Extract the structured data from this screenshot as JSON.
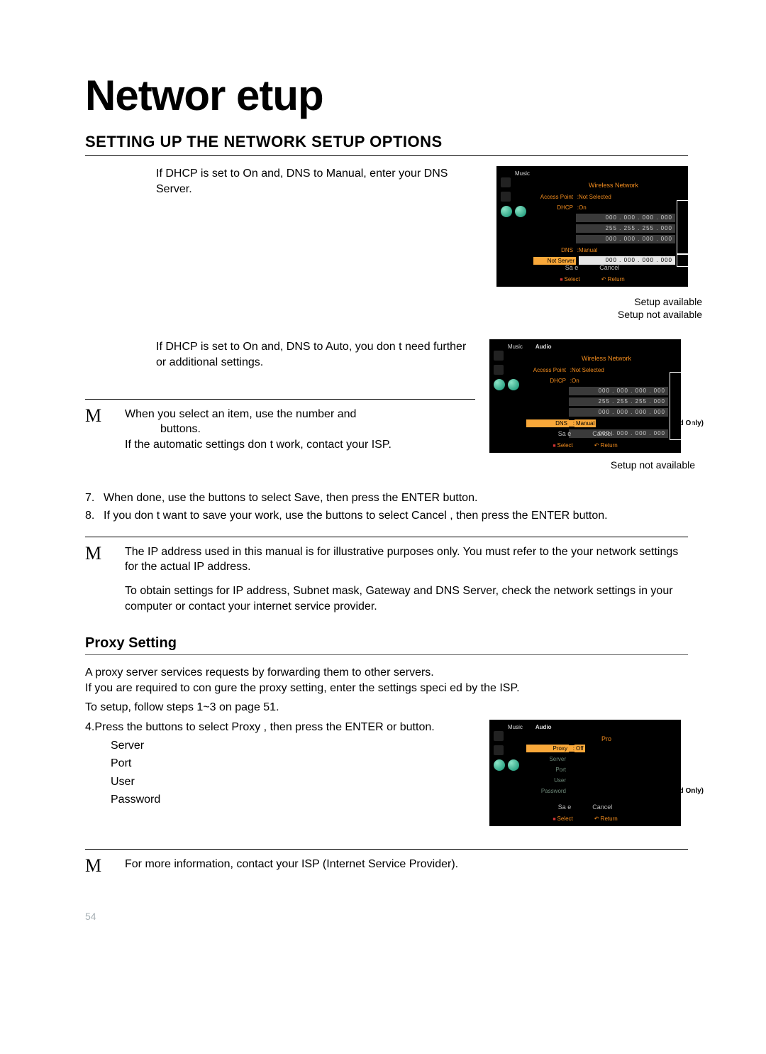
{
  "h1": "Networ etup",
  "h2": "SETTING UP THE NETWORK SETUP OPTIONS",
  "p_dhcp_manual": "If DHCP is set to On and, DNS to Manual, enter your DNS Server.",
  "p_dhcp_auto": "If DHCP is set to On and, DNS to Auto, you don t need further or additional settings.",
  "note1_a": "When you select an item, use the number and",
  "note1_b": "buttons.",
  "note1_c": "If the automatic settings don t work, contact your ISP.",
  "step7": "When done, use the         buttons to select Save, then press the ENTER button.",
  "step8": "If you don t want to save your work, use the             buttons to select Cancel , then press the ENTER button.",
  "note2_a": "The IP address used in this manual is for illustrative purposes only. You must refer to the your network settings for the actual IP address.",
  "note2_b": "To obtain settings for IP address, Subnet mask, Gateway and DNS Server, check the network settings in your computer or contact your internet service provider.",
  "h3_proxy": "Proxy Setting",
  "proxy_p1": "A proxy server services requests by forwarding them to other servers.",
  "proxy_p2": "If you are required to con gure the proxy setting, enter the settings speci ed by the ISP.",
  "proxy_p3": "To setup, follow steps 1~3 on page 51.",
  "proxy_step4_a": "Press the         buttons to select Proxy , then press the ENTER or       button.",
  "proxy_fields": [
    "Server",
    "Port",
    "User",
    "Password"
  ],
  "note3": "For more information, contact your ISP (Internet Service Provider).",
  "caption_available": "Setup available",
  "caption_notavailable": "Setup not available",
  "valid_only": "(Valid Only)",
  "page_num": "54",
  "screen": {
    "tabs": {
      "music": "Music",
      "audio": "Audio"
    },
    "title_wireless": "Wireless Network",
    "title_proxy": "Pro",
    "ap_label": "Access Point",
    "ap_val": "Not Selected",
    "dhcp_label": "DHCP",
    "dhcp_val": "On",
    "ip_000": "000 . 000 . 000 . 000",
    "ip_255": "255 . 255 . 255 . 000",
    "dns_label": "DNS",
    "dns_manual": "Manual",
    "dnssrv_label": "Not Server",
    "save": "Sa e",
    "cancel": "Cancel",
    "select": "Select",
    "return": "Return",
    "proxy_label": "Proxy",
    "proxy_off": "Off",
    "proxy_server": "Server",
    "proxy_port": "Port",
    "proxy_user": "User",
    "proxy_password": "Password"
  }
}
